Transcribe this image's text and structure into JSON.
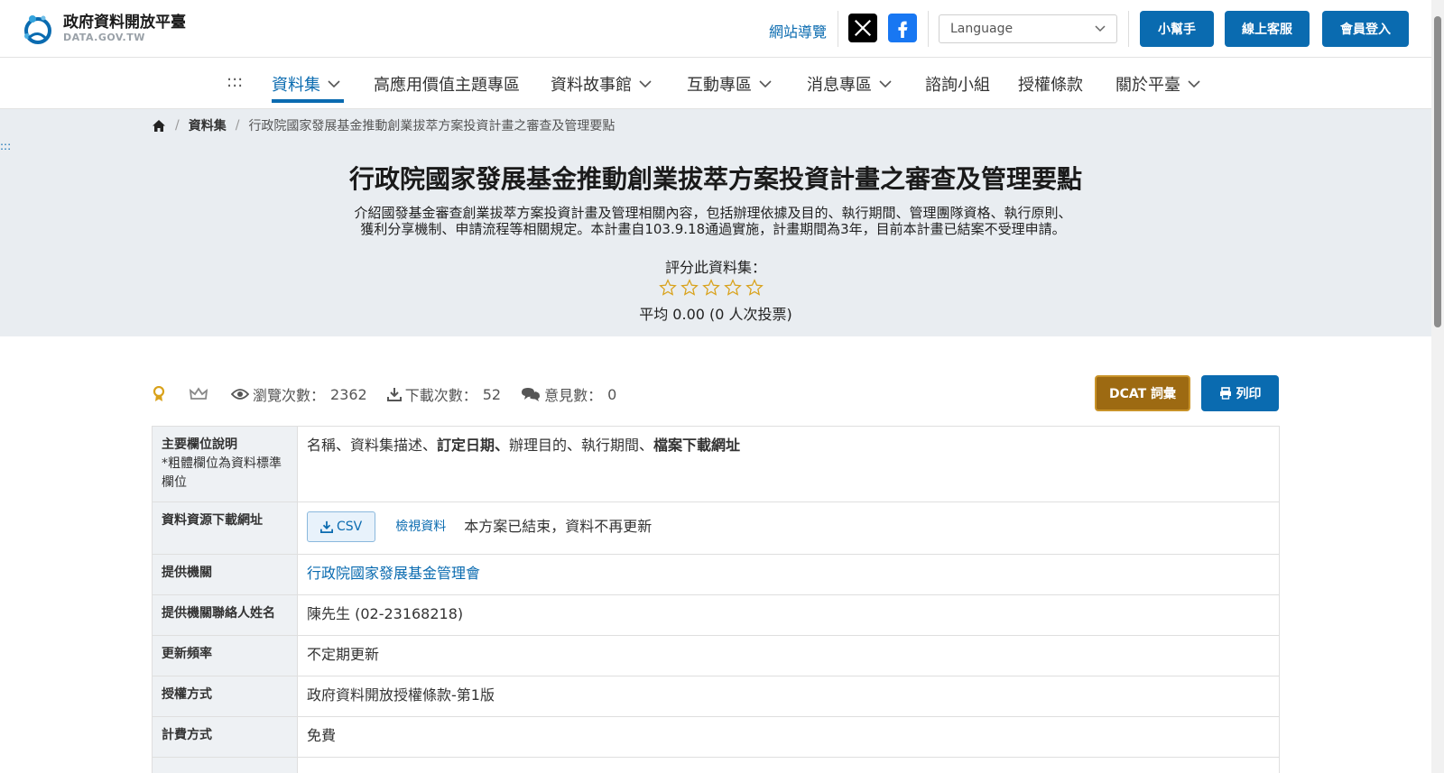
{
  "header": {
    "logo_title": "政府資料開放平臺",
    "logo_sub": "DATA.GOV.TW",
    "site_nav": "網站導覽",
    "language_placeholder": "Language",
    "btn_helper": "小幫手",
    "btn_service": "線上客服",
    "btn_login": "會員登入",
    "accent_color": "#0a6bb0"
  },
  "nav": {
    "dots": ":::",
    "items": [
      {
        "label": "資料集",
        "dropdown": true,
        "active": true
      },
      {
        "label": "高應用價值主題專區",
        "dropdown": false
      },
      {
        "label": "資料故事館",
        "dropdown": true
      },
      {
        "label": "互動專區",
        "dropdown": true
      },
      {
        "label": "消息專區",
        "dropdown": true
      },
      {
        "label": "諮詢小組",
        "dropdown": false
      },
      {
        "label": "授權條款",
        "dropdown": false
      },
      {
        "label": "關於平臺",
        "dropdown": true
      }
    ]
  },
  "breadcrumb": {
    "home_icon": "home-icon",
    "level1": "資料集",
    "current": "行政院國家發展基金推動創業拔萃方案投資計畫之審查及管理要點"
  },
  "side_dots": ":::",
  "dataset": {
    "title": "行政院國家發展基金推動創業拔萃方案投資計畫之審查及管理要點",
    "description_line1": "介紹國發基金審查創業拔萃方案投資計畫及管理相關內容，包括辦理依據及目的、執行期間、管理團隊資格、執行原則、",
    "description_line2": "獲利分享機制、申請流程等相關規定。本計畫自103.9.18通過實施，計畫期間為3年，目前本計畫已結案不受理申請。",
    "rating_label": "評分此資料集：",
    "rating_value": 0,
    "rating_max": 5,
    "rating_avg": "平均 0.00 (0 人次投票)"
  },
  "stats": {
    "views_label": "瀏覽次數：",
    "views": "2362",
    "downloads_label": "下載次數：",
    "downloads": "52",
    "comments_label": "意見數：",
    "comments": "0"
  },
  "actions": {
    "dcat": "DCAT 詞彙",
    "print": "列印"
  },
  "table": {
    "fields_label": "主要欄位說明",
    "fields_note": "*粗體欄位為資料標準欄位",
    "fields_parts": [
      {
        "text": "名稱、資料集描述、",
        "bold": false
      },
      {
        "text": "訂定日期、",
        "bold": true
      },
      {
        "text": "辦理目的、執行期間、",
        "bold": false
      },
      {
        "text": "檔案下載網址",
        "bold": true
      }
    ],
    "resource_label": "資料資源下載網址",
    "resource_format": "CSV",
    "resource_view": "檢視資料",
    "resource_note": "本方案已結束，資料不再更新",
    "provider_label": "提供機關",
    "provider": "行政院國家發展基金管理會",
    "contact_label": "提供機關聯絡人姓名",
    "contact": "陳先生 (02-23168218)",
    "frequency_label": "更新頻率",
    "frequency": "不定期更新",
    "license_label": "授權方式",
    "license": "政府資料開放授權條款-第1版",
    "fee_label": "計費方式",
    "fee": "免費"
  }
}
